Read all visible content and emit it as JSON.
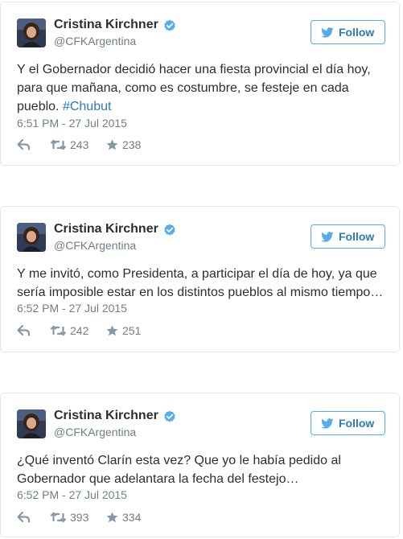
{
  "tweets": [
    {
      "author_name": "Cristina Kirchner",
      "handle": "@CFKArgentina",
      "follow_label": "Follow",
      "text_before_hashtag": "Y el Gobernador decidió hacer una fiesta provincial el día hoy, para que mañana, como es costumbre, se festeje en cada pueblo. ",
      "hashtag": "#Chubut",
      "timestamp": "6:51 PM - 27 Jul 2015",
      "retweets": "243",
      "favorites": "238"
    },
    {
      "author_name": "Cristina Kirchner",
      "handle": "@CFKArgentina",
      "follow_label": "Follow",
      "text_before_hashtag": "Y me invitó, como Presidenta, a participar el día de hoy, ya que sería imposible estar en los distintos pueblos al mismo tiempo…",
      "hashtag": "",
      "timestamp": "6:52 PM - 27 Jul 2015",
      "retweets": "242",
      "favorites": "251"
    },
    {
      "author_name": "Cristina Kirchner",
      "handle": "@CFKArgentina",
      "follow_label": "Follow",
      "text_before_hashtag": "¿Qué inventó Clarín esta vez? Que yo le había pedido al Gobernador que adelantara la fecha del festejo…",
      "hashtag": "",
      "timestamp": "6:52 PM - 27 Jul 2015",
      "retweets": "393",
      "favorites": "334"
    }
  ],
  "colors": {
    "verified_badge": "#55acee",
    "follow_border": "#55acee",
    "follow_text": "#2b7bb9",
    "hashtag": "#2b7bb9",
    "meta_text": "#707e88",
    "action_icon": "#8899a6",
    "card_border": "#e1e8ed"
  },
  "icons": {
    "verified": "verified-badge-icon",
    "follow": "twitter-bird-icon",
    "reply": "reply-icon",
    "retweet": "retweet-icon",
    "favorite": "star-icon"
  }
}
